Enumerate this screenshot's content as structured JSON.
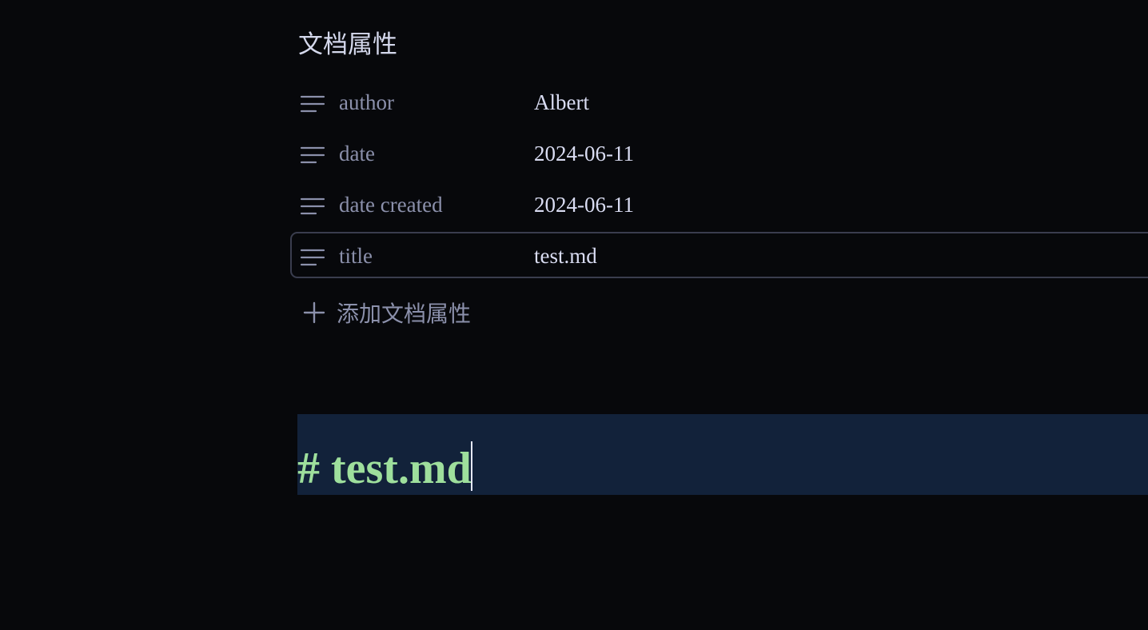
{
  "properties_panel": {
    "heading": "文档属性",
    "items": [
      {
        "key": "author",
        "value": "Albert",
        "icon": "text-lines-icon"
      },
      {
        "key": "date",
        "value": "2024-06-11",
        "icon": "text-lines-icon"
      },
      {
        "key": "date created",
        "value": "2024-06-11",
        "icon": "text-lines-icon"
      },
      {
        "key": "title",
        "value": "test.md",
        "icon": "text-lines-icon"
      }
    ],
    "add_label": "添加文档属性",
    "add_icon": "plus-icon"
  },
  "editor": {
    "heading_line": "# test.md"
  },
  "colors": {
    "background": "#07080b",
    "heading_text": "#9edf9c",
    "active_line": "#12223a",
    "muted_text": "#8b90ab",
    "value_text": "#d9dcf2"
  }
}
